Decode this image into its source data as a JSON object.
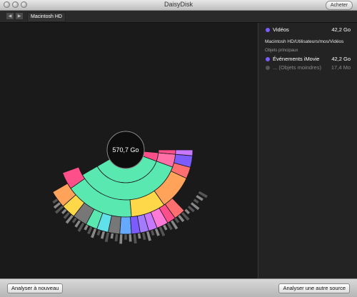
{
  "app": {
    "title": "DaisyDisk",
    "buy_label": "Acheter"
  },
  "toolbar": {
    "back_glyph": "◀",
    "forward_glyph": "▶",
    "breadcrumb": "Macintosh HD"
  },
  "chart": {
    "center_label": "570,7 Go"
  },
  "sidebar": {
    "selected": {
      "label": "Vidéos",
      "size": "42,2 Go",
      "color": "#7c5cff"
    },
    "path": "Macintosh HD/Utilisateurs/mos/Vidéos",
    "section_title": "Objets principaux",
    "items": [
      {
        "label": "Événements iMovie",
        "size": "42,2 Go",
        "color": "#7c5cff"
      },
      {
        "label": "... (Objets moindres)",
        "size": "17,4 Mo",
        "color": "#666666"
      }
    ]
  },
  "bottom": {
    "rescan_label": "Analyser à nouveau",
    "other_source_label": "Analyser une autre source"
  }
}
